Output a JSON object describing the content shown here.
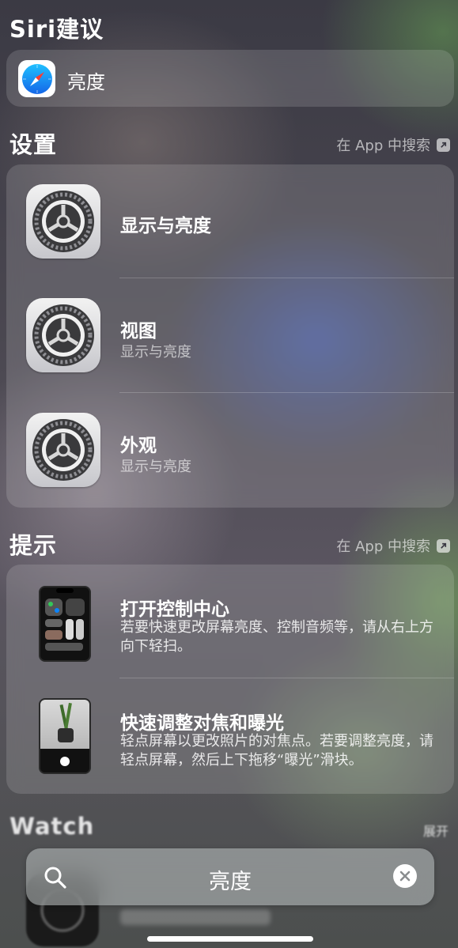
{
  "siri": {
    "title": "Siri建议",
    "suggestion": {
      "label": "亮度",
      "icon": "safari-icon"
    }
  },
  "settings": {
    "title": "设置",
    "search_in_app": "在 App 中搜索",
    "rows": [
      {
        "title": "显示与亮度",
        "subtitle": ""
      },
      {
        "title": "视图",
        "subtitle": "显示与亮度"
      },
      {
        "title": "外观",
        "subtitle": "显示与亮度"
      }
    ]
  },
  "tips": {
    "title": "提示",
    "search_in_app": "在 App 中搜索",
    "rows": [
      {
        "title": "打开控制中心",
        "desc": "若要快速更改屏幕亮度、控制音频等，请从右上方向下轻扫。"
      },
      {
        "title": "快速调整对焦和曝光",
        "desc": "轻点屏幕以更改照片的对焦点。若要调整亮度，请轻点屏幕，然后上下拖移“曝光”滑块。"
      }
    ]
  },
  "watch": {
    "title": "Watch",
    "expand": "展开"
  },
  "search": {
    "query": "亮度"
  },
  "colors": {
    "safari_blue": "#1a8cff",
    "accent_white": "#ffffff"
  }
}
